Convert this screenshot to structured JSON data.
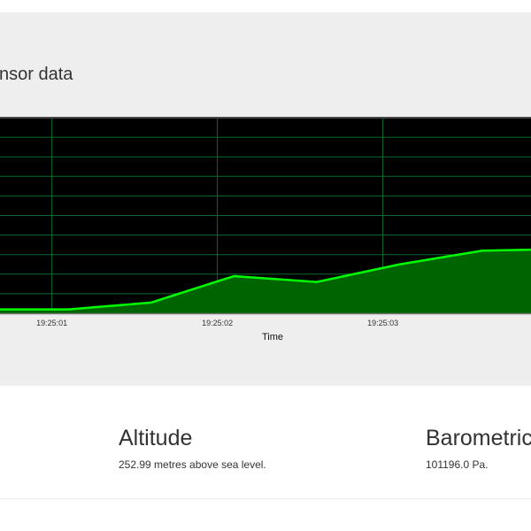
{
  "header": {
    "title": "nsor data"
  },
  "chart_data": {
    "type": "area",
    "title": "",
    "xlabel": "Time",
    "ylabel": "",
    "x_ticks": [
      "19:25:01",
      "19:25:02",
      "19:25:03"
    ],
    "x": [
      "19:25:00.7",
      "19:25:01.1",
      "19:25:01.6",
      "19:25:02.1",
      "19:25:02.6",
      "19:25:03.1",
      "19:25:03.6",
      "19:25:03.9"
    ],
    "values": [
      0.2,
      0.2,
      0.55,
      1.9,
      1.6,
      2.5,
      3.2,
      3.25
    ],
    "ylim": [
      0,
      10
    ],
    "grid": true,
    "colors": {
      "background": "#000000",
      "grid": "#0b6b32",
      "line": "#00ff00",
      "fill": "#006400"
    }
  },
  "cards": [
    {
      "title": "Altitude",
      "value": "252.99 metres above sea level."
    },
    {
      "title": "Barometric",
      "value": "101196.0 Pa."
    }
  ]
}
